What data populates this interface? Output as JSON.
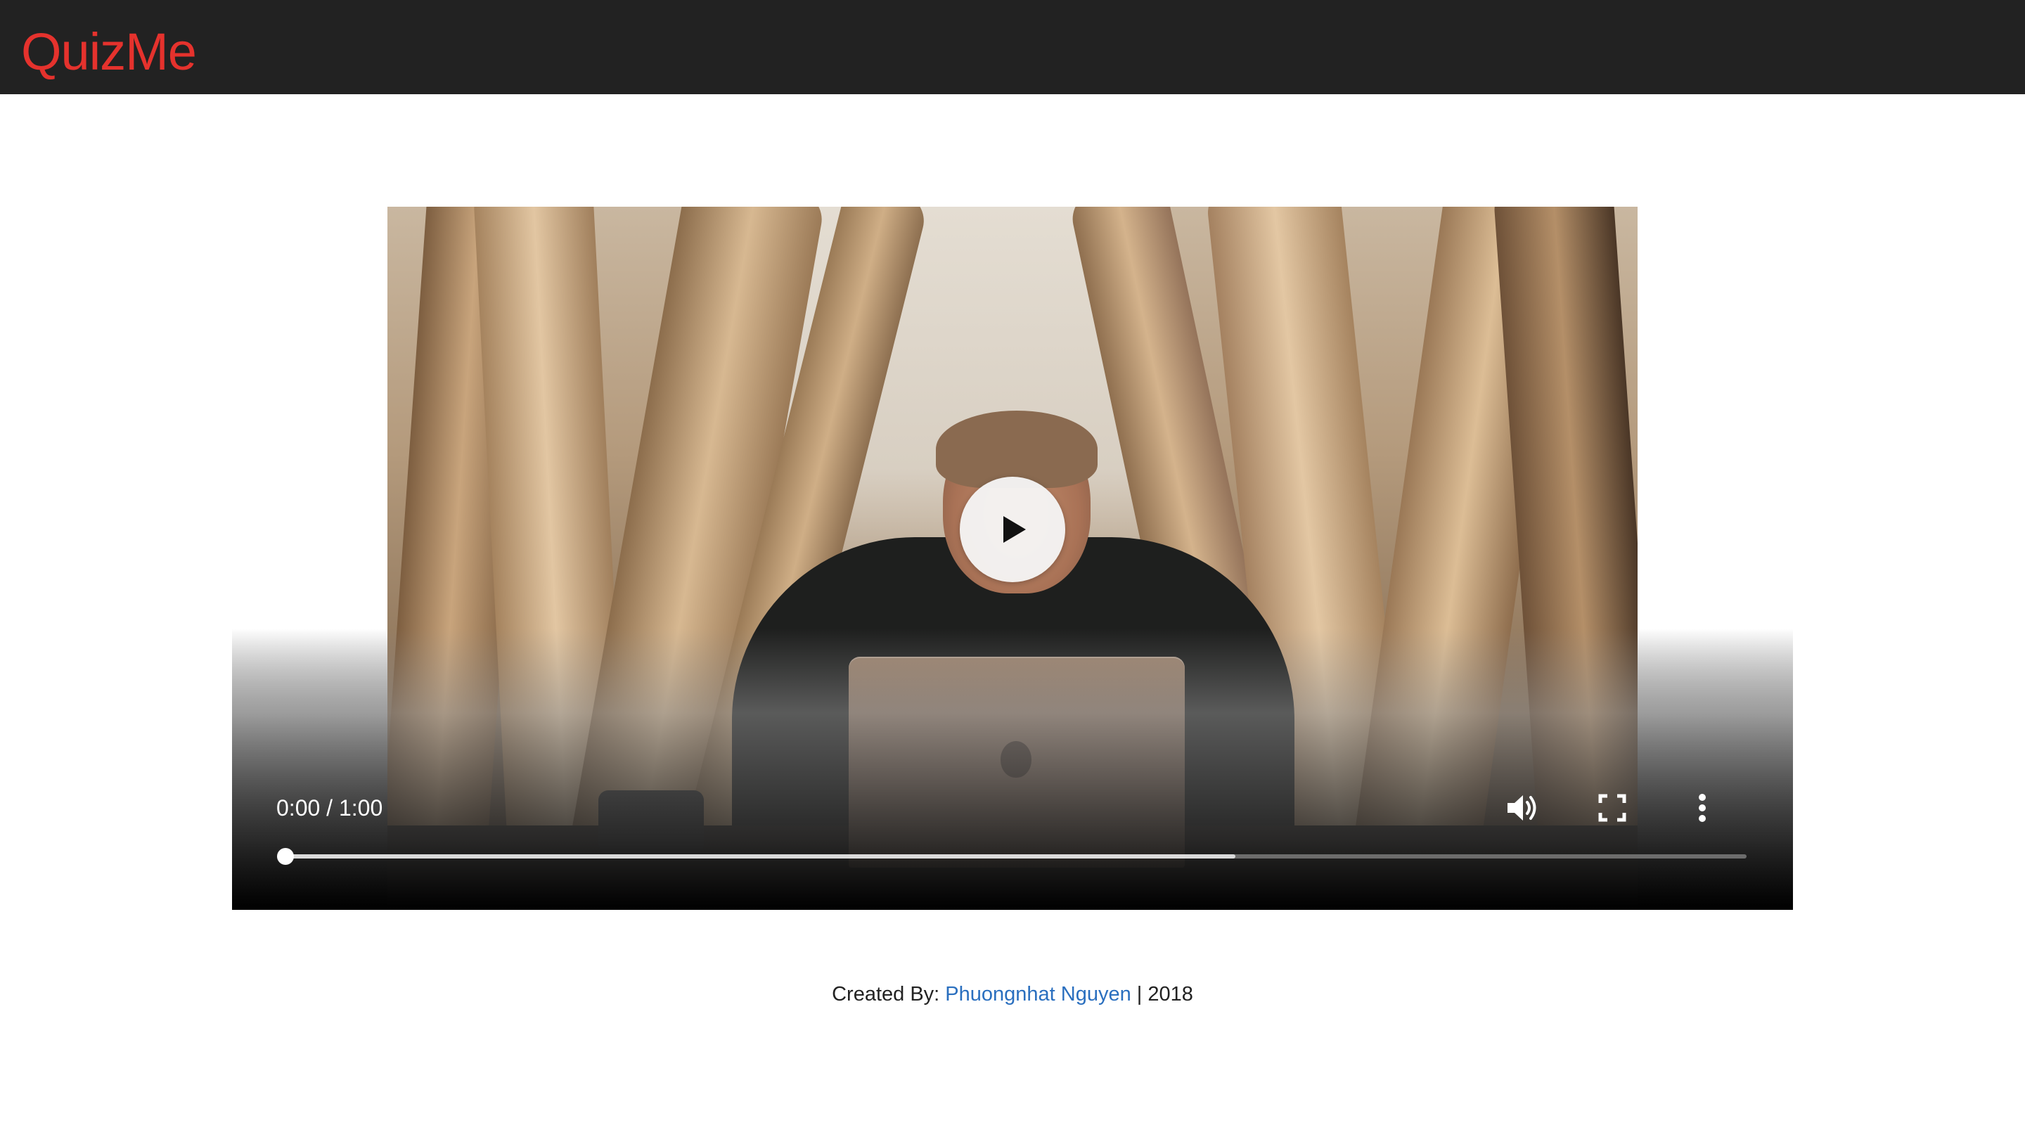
{
  "header": {
    "brand": "QuizMe",
    "brand_color": "#e5322d",
    "background": "#222222"
  },
  "video": {
    "time_current": "0:00",
    "time_separator": " / ",
    "time_total": "1:00",
    "time_label": "0:00 / 1:00",
    "played_fraction": 0,
    "buffered_fraction": 0.65,
    "state": "paused",
    "icons": {
      "play": "play-icon",
      "volume": "volume-icon",
      "fullscreen": "fullscreen-icon",
      "more": "more-options-icon"
    }
  },
  "footer": {
    "prefix": "Created By: ",
    "author": "Phuongnhat Nguyen",
    "suffix": " | 2018",
    "link_color": "#2a6fbf"
  }
}
